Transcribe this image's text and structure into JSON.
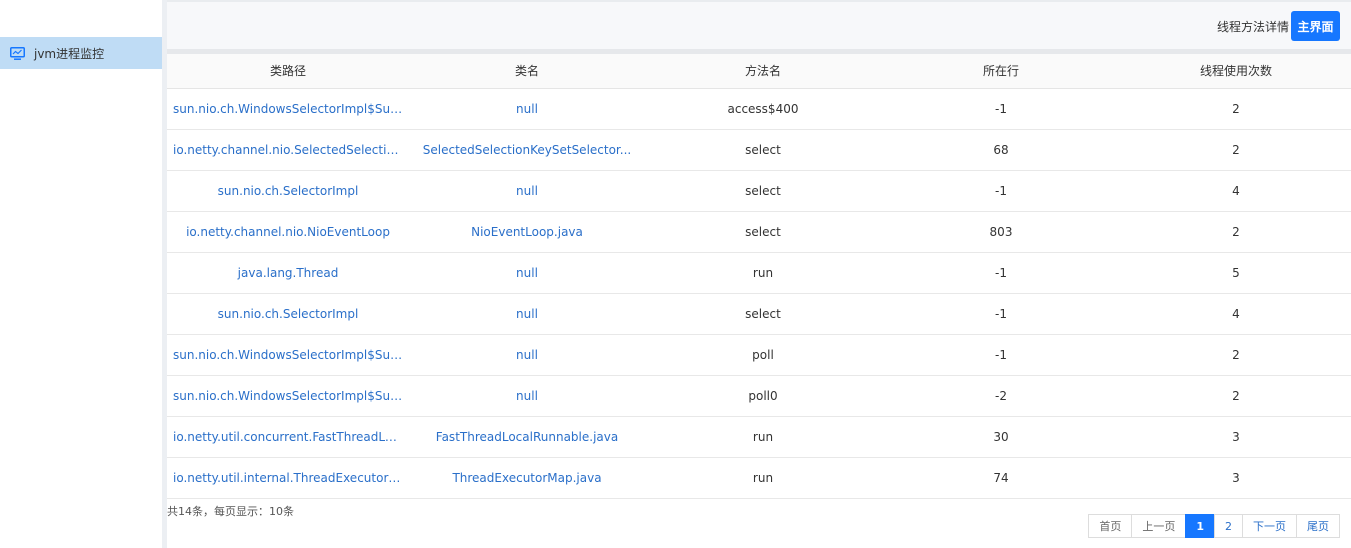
{
  "sidebar": {
    "items": [
      {
        "label": "jvm进程监控",
        "icon": "monitor-icon"
      }
    ]
  },
  "header": {
    "title": "线程方法详情",
    "main_button": "主界面"
  },
  "table": {
    "columns": [
      "类路径",
      "类名",
      "方法名",
      "所在行",
      "线程使用次数"
    ],
    "rows": [
      [
        "sun.nio.ch.WindowsSelectorImpl$SubSel...",
        "null",
        "access$400",
        "-1",
        "2"
      ],
      [
        "io.netty.channel.nio.SelectedSelectionKe...",
        "SelectedSelectionKeySetSelector...",
        "select",
        "68",
        "2"
      ],
      [
        "sun.nio.ch.SelectorImpl",
        "null",
        "select",
        "-1",
        "4"
      ],
      [
        "io.netty.channel.nio.NioEventLoop",
        "NioEventLoop.java",
        "select",
        "803",
        "2"
      ],
      [
        "java.lang.Thread",
        "null",
        "run",
        "-1",
        "5"
      ],
      [
        "sun.nio.ch.SelectorImpl",
        "null",
        "select",
        "-1",
        "4"
      ],
      [
        "sun.nio.ch.WindowsSelectorImpl$SubSel...",
        "null",
        "poll",
        "-1",
        "2"
      ],
      [
        "sun.nio.ch.WindowsSelectorImpl$SubSel...",
        "null",
        "poll0",
        "-2",
        "2"
      ],
      [
        "io.netty.util.concurrent.FastThreadLocalR...",
        "FastThreadLocalRunnable.java",
        "run",
        "30",
        "3"
      ],
      [
        "io.netty.util.internal.ThreadExecutorMap...",
        "ThreadExecutorMap.java",
        "run",
        "74",
        "3"
      ]
    ]
  },
  "footer": {
    "summary": "共14条，每页显示：10条",
    "pager": {
      "first": "首页",
      "prev": "上一页",
      "pages": [
        "1",
        "2"
      ],
      "current": "1",
      "next": "下一页",
      "last": "尾页"
    }
  },
  "colors": {
    "accent": "#1677ff",
    "link": "#2a6fc9",
    "nav_active": "#bfdcf5"
  }
}
